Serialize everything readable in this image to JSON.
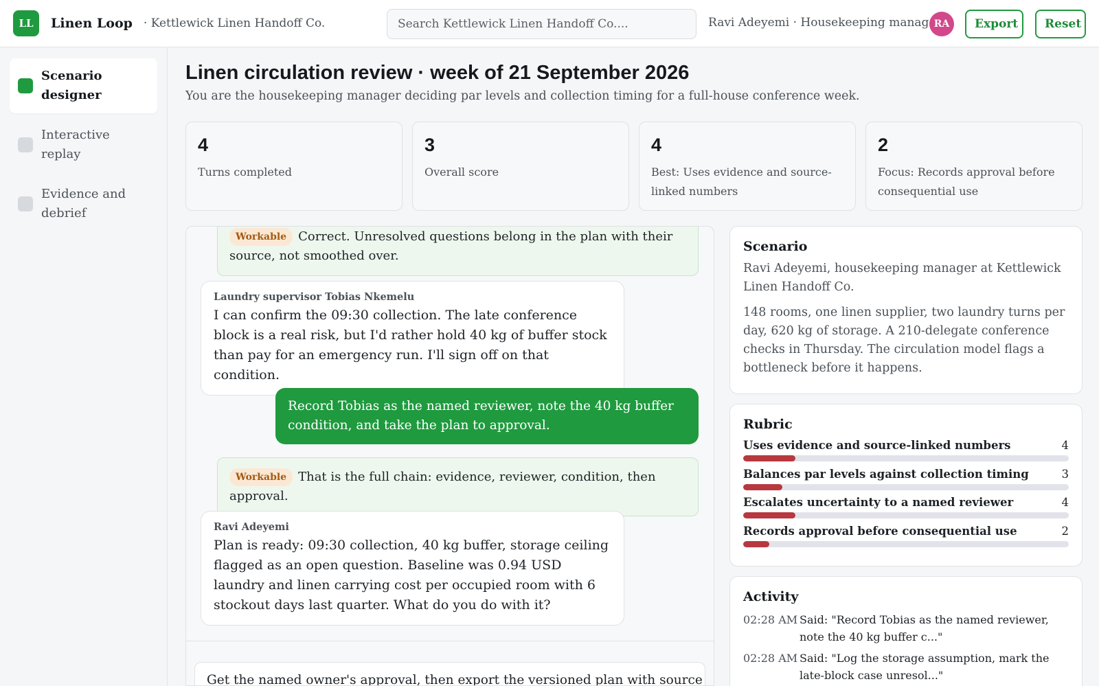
{
  "header": {
    "logo_initials": "LL",
    "app_name": "Linen Loop",
    "org": "· Kettlewick Linen Handoff Co.",
    "search_placeholder": "Search Kettlewick Linen Handoff Co....",
    "user": "Ravi Adeyemi · Housekeeping manager",
    "avatar_initials": "RA",
    "export_label": "Export",
    "reset_label": "Reset"
  },
  "sidebar": {
    "items": [
      {
        "label": "Scenario designer",
        "active": true
      },
      {
        "label": "Interactive replay",
        "active": false
      },
      {
        "label": "Evidence and debrief",
        "active": false
      }
    ]
  },
  "page": {
    "title": "Linen circulation review · week of 21 September 2026",
    "subtitle": "You are the housekeeping manager deciding par levels and collection timing for a full-house conference week."
  },
  "stats": [
    {
      "value": "4",
      "label": "Turns completed"
    },
    {
      "value": "3",
      "label": "Overall score"
    },
    {
      "value": "4",
      "label": "Best: Uses evidence and source-linked numbers"
    },
    {
      "value": "2",
      "label": "Focus: Records approval before consequential use"
    }
  ],
  "conversation": {
    "feedback_1": {
      "badge": "Workable",
      "text": "Correct. Unresolved questions belong in the plan with their source, not smoothed over."
    },
    "msg_1": {
      "author": "Laundry supervisor Tobias Nkemelu",
      "text": "I can confirm the 09:30 collection. The late conference block is a real risk, but I'd rather hold 40 kg of buffer stock than pay for an emergency run. I'll sign off on that condition."
    },
    "user_msg": "Record Tobias as the named reviewer, note the 40 kg buffer condition, and take the plan to approval.",
    "feedback_2": {
      "badge": "Workable",
      "text": "That is the full chain: evidence, reviewer, condition, then approval."
    },
    "msg_2": {
      "author": "Ravi Adeyemi",
      "text": "Plan is ready: 09:30 collection, 40 kg buffer, storage ceiling flagged as an open question. Baseline was 0.94 USD laundry and linen carrying cost per occupied room with 6 stockout days last quarter. What do you do with it?"
    },
    "composer_value": "Get the named owner's approval, then export the versioned plan with source"
  },
  "scenario": {
    "title": "Scenario",
    "p1": "Ravi Adeyemi, housekeeping manager at Kettlewick Linen Handoff Co.",
    "p2": "148 rooms, one linen supplier, two laundry turns per day, 620 kg of storage. A 210-delegate conference checks in Thursday. The circulation model flags a bottleneck before it happens."
  },
  "rubric": {
    "title": "Rubric",
    "max": 25,
    "items": [
      {
        "name": "Uses evidence and source-linked numbers",
        "score": 4
      },
      {
        "name": "Balances par levels against collection timing",
        "score": 3
      },
      {
        "name": "Escalates uncertainty to a named reviewer",
        "score": 4
      },
      {
        "name": "Records approval before consequential use",
        "score": 2
      }
    ],
    "fill_color": "#b8383f"
  },
  "activity": {
    "title": "Activity",
    "items": [
      {
        "time": "02:28 AM",
        "text": "Said: \"Record Tobias as the named reviewer, note the 40 kg buffer c...\""
      },
      {
        "time": "02:28 AM",
        "text": "Said: \"Log the storage assumption, mark the late-block case unresol...\""
      }
    ]
  },
  "colors": {
    "accent": "#1f9a3f",
    "avatar": "#d2488a",
    "badge_bg": "#fbe8d4"
  }
}
